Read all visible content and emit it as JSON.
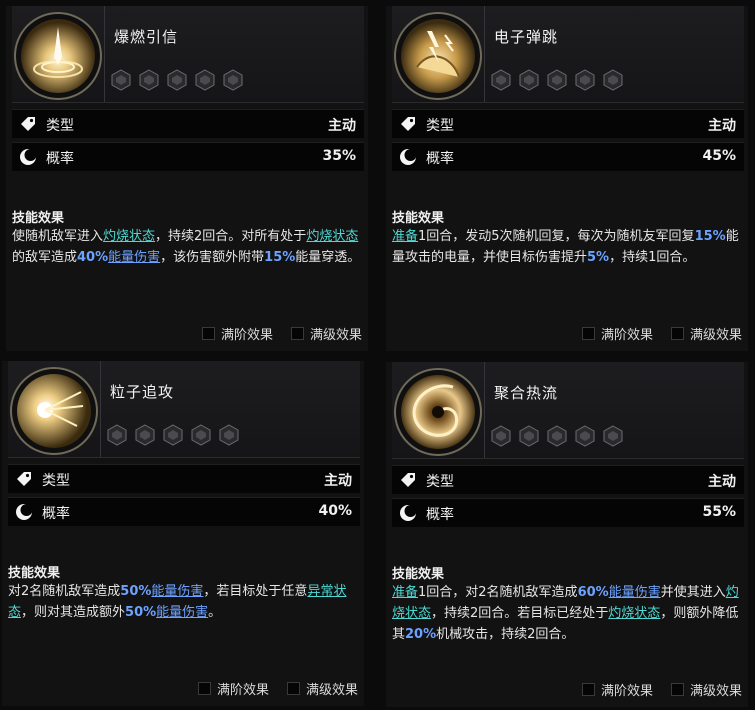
{
  "labels": {
    "type": "类型",
    "rate": "概率",
    "effect_title": "技能效果",
    "full_rank": "满阶效果",
    "full_level": "满级效果"
  },
  "cards": [
    {
      "name": "爆燃引信",
      "type_value": "主动",
      "rate_value": "35%",
      "icon": "fire-spark-icon",
      "effect": [
        {
          "t": "使随机敌军进入",
          "s": ""
        },
        {
          "t": "灼烧状态",
          "s": "cyan"
        },
        {
          "t": "，持续2回合。对所有处于",
          "s": ""
        },
        {
          "t": "灼烧状态",
          "s": "cyan"
        },
        {
          "t": "的敌军造成",
          "s": ""
        },
        {
          "t": "40%",
          "s": "blue"
        },
        {
          "t": "能量伤害",
          "s": "blue-u"
        },
        {
          "t": "，该伤害额外附带",
          "s": ""
        },
        {
          "t": "15%",
          "s": "blue"
        },
        {
          "t": "能量穿透。",
          "s": ""
        }
      ]
    },
    {
      "name": "电子弹跳",
      "type_value": "主动",
      "rate_value": "45%",
      "icon": "lightning-hand-icon",
      "effect": [
        {
          "t": "准备",
          "s": "cyan"
        },
        {
          "t": "1回合，发动5次随机回复，每次为随机友军回复",
          "s": ""
        },
        {
          "t": "15%",
          "s": "blue"
        },
        {
          "t": "能量攻击的电量，并使目标伤害提升",
          "s": ""
        },
        {
          "t": "5%",
          "s": "blue"
        },
        {
          "t": "，持续1回合。",
          "s": ""
        }
      ]
    },
    {
      "name": "粒子追攻",
      "type_value": "主动",
      "rate_value": "40%",
      "icon": "particle-burst-icon",
      "effect": [
        {
          "t": "对2名随机敌军造成",
          "s": ""
        },
        {
          "t": "50%",
          "s": "blue"
        },
        {
          "t": "能量伤害",
          "s": "blue-u"
        },
        {
          "t": "，若目标处于任意",
          "s": ""
        },
        {
          "t": "异常状态",
          "s": "cyan"
        },
        {
          "t": "，则对其造成额外",
          "s": ""
        },
        {
          "t": "50%",
          "s": "blue"
        },
        {
          "t": "能量伤害",
          "s": "blue-u"
        },
        {
          "t": "。",
          "s": ""
        }
      ]
    },
    {
      "name": "聚合热流",
      "type_value": "主动",
      "rate_value": "55%",
      "icon": "vortex-icon",
      "effect": [
        {
          "t": "准备",
          "s": "cyan"
        },
        {
          "t": "1回合，对2名随机敌军造成",
          "s": ""
        },
        {
          "t": "60%",
          "s": "blue"
        },
        {
          "t": "能量伤害",
          "s": "blue-u"
        },
        {
          "t": "并使其进入",
          "s": ""
        },
        {
          "t": "灼烧状态",
          "s": "cyan"
        },
        {
          "t": "，持续2回合。若目标已经处于",
          "s": ""
        },
        {
          "t": "灼烧状态",
          "s": "cyan"
        },
        {
          "t": "，则额外降低其",
          "s": ""
        },
        {
          "t": "20%",
          "s": "blue"
        },
        {
          "t": "机械攻击，持续2回合。",
          "s": ""
        }
      ]
    }
  ]
}
